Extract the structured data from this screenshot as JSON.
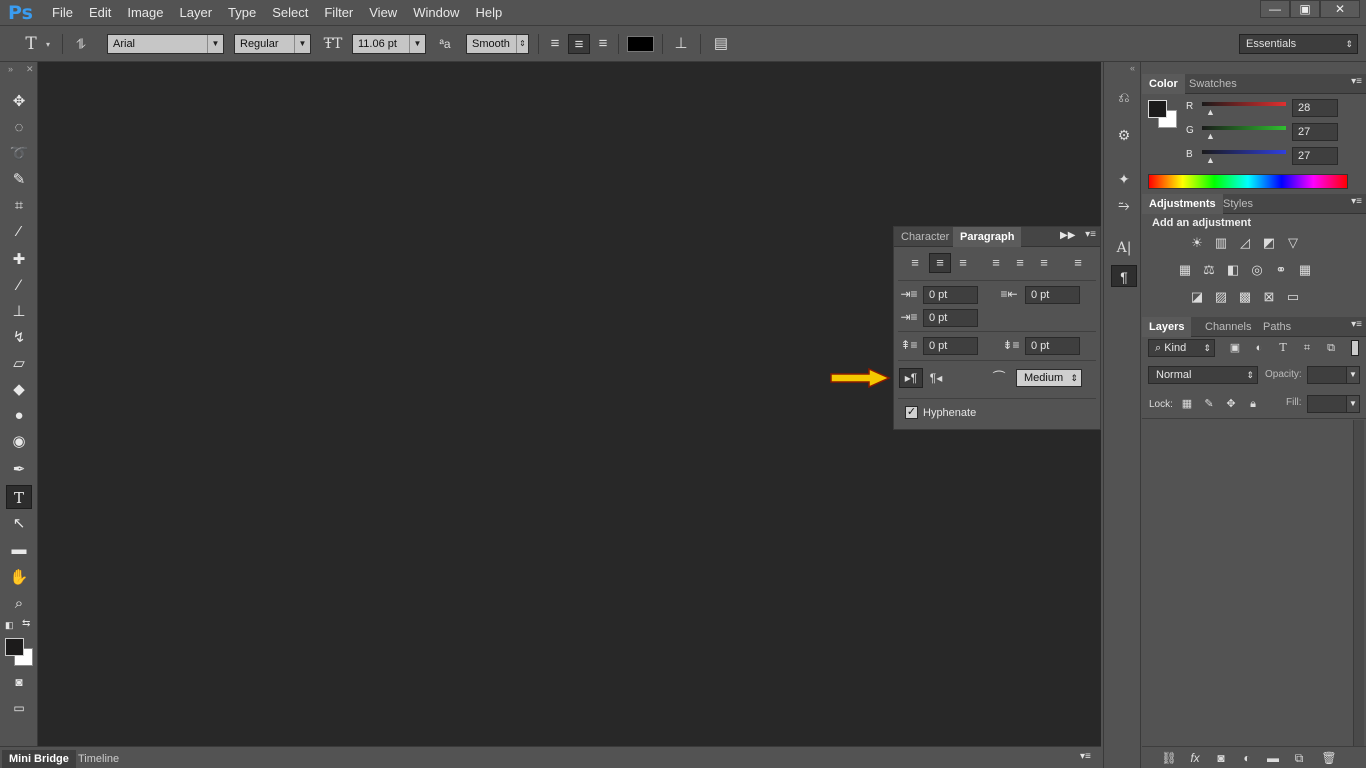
{
  "app": {
    "logo": "Ps"
  },
  "menu": [
    "File",
    "Edit",
    "Image",
    "Layer",
    "Type",
    "Select",
    "Filter",
    "View",
    "Window",
    "Help"
  ],
  "window_controls": {
    "minimize": "—",
    "restore": "▣",
    "close": "✕"
  },
  "options": {
    "font_family": "Arial",
    "font_style": "Regular",
    "font_size": "11.06 pt",
    "antialias_icon": "ªa",
    "antialias": "Smooth",
    "text_color": "#000000",
    "workspace": "Essentials"
  },
  "bottom_tabs": [
    "Mini Bridge",
    "Timeline"
  ],
  "color_panel": {
    "tabs": [
      "Color",
      "Swatches"
    ],
    "channels": [
      {
        "label": "R",
        "value": "28",
        "color": "#e03030"
      },
      {
        "label": "G",
        "value": "27",
        "color": "#30c030"
      },
      {
        "label": "B",
        "value": "27",
        "color": "#3040e0"
      }
    ]
  },
  "adjustments_panel": {
    "tabs": [
      "Adjustments",
      "Styles"
    ],
    "heading": "Add an adjustment"
  },
  "layers_panel": {
    "tabs": [
      "Layers",
      "Channels",
      "Paths"
    ],
    "filter": "Kind",
    "blend_mode": "Normal",
    "opacity_label": "Opacity:",
    "lock_label": "Lock:",
    "fill_label": "Fill:"
  },
  "paragraph_panel": {
    "tabs": [
      "Character",
      "Paragraph"
    ],
    "indent_left": "0 pt",
    "indent_right": "0 pt",
    "indent_first": "0 pt",
    "space_before": "0 pt",
    "space_after": "0 pt",
    "composer": "Medium",
    "hyphenate_label": "Hyphenate",
    "hyphenate_checked": true
  },
  "accent": {
    "arrow": "#f5c800",
    "logo": "#3a9cf0"
  }
}
